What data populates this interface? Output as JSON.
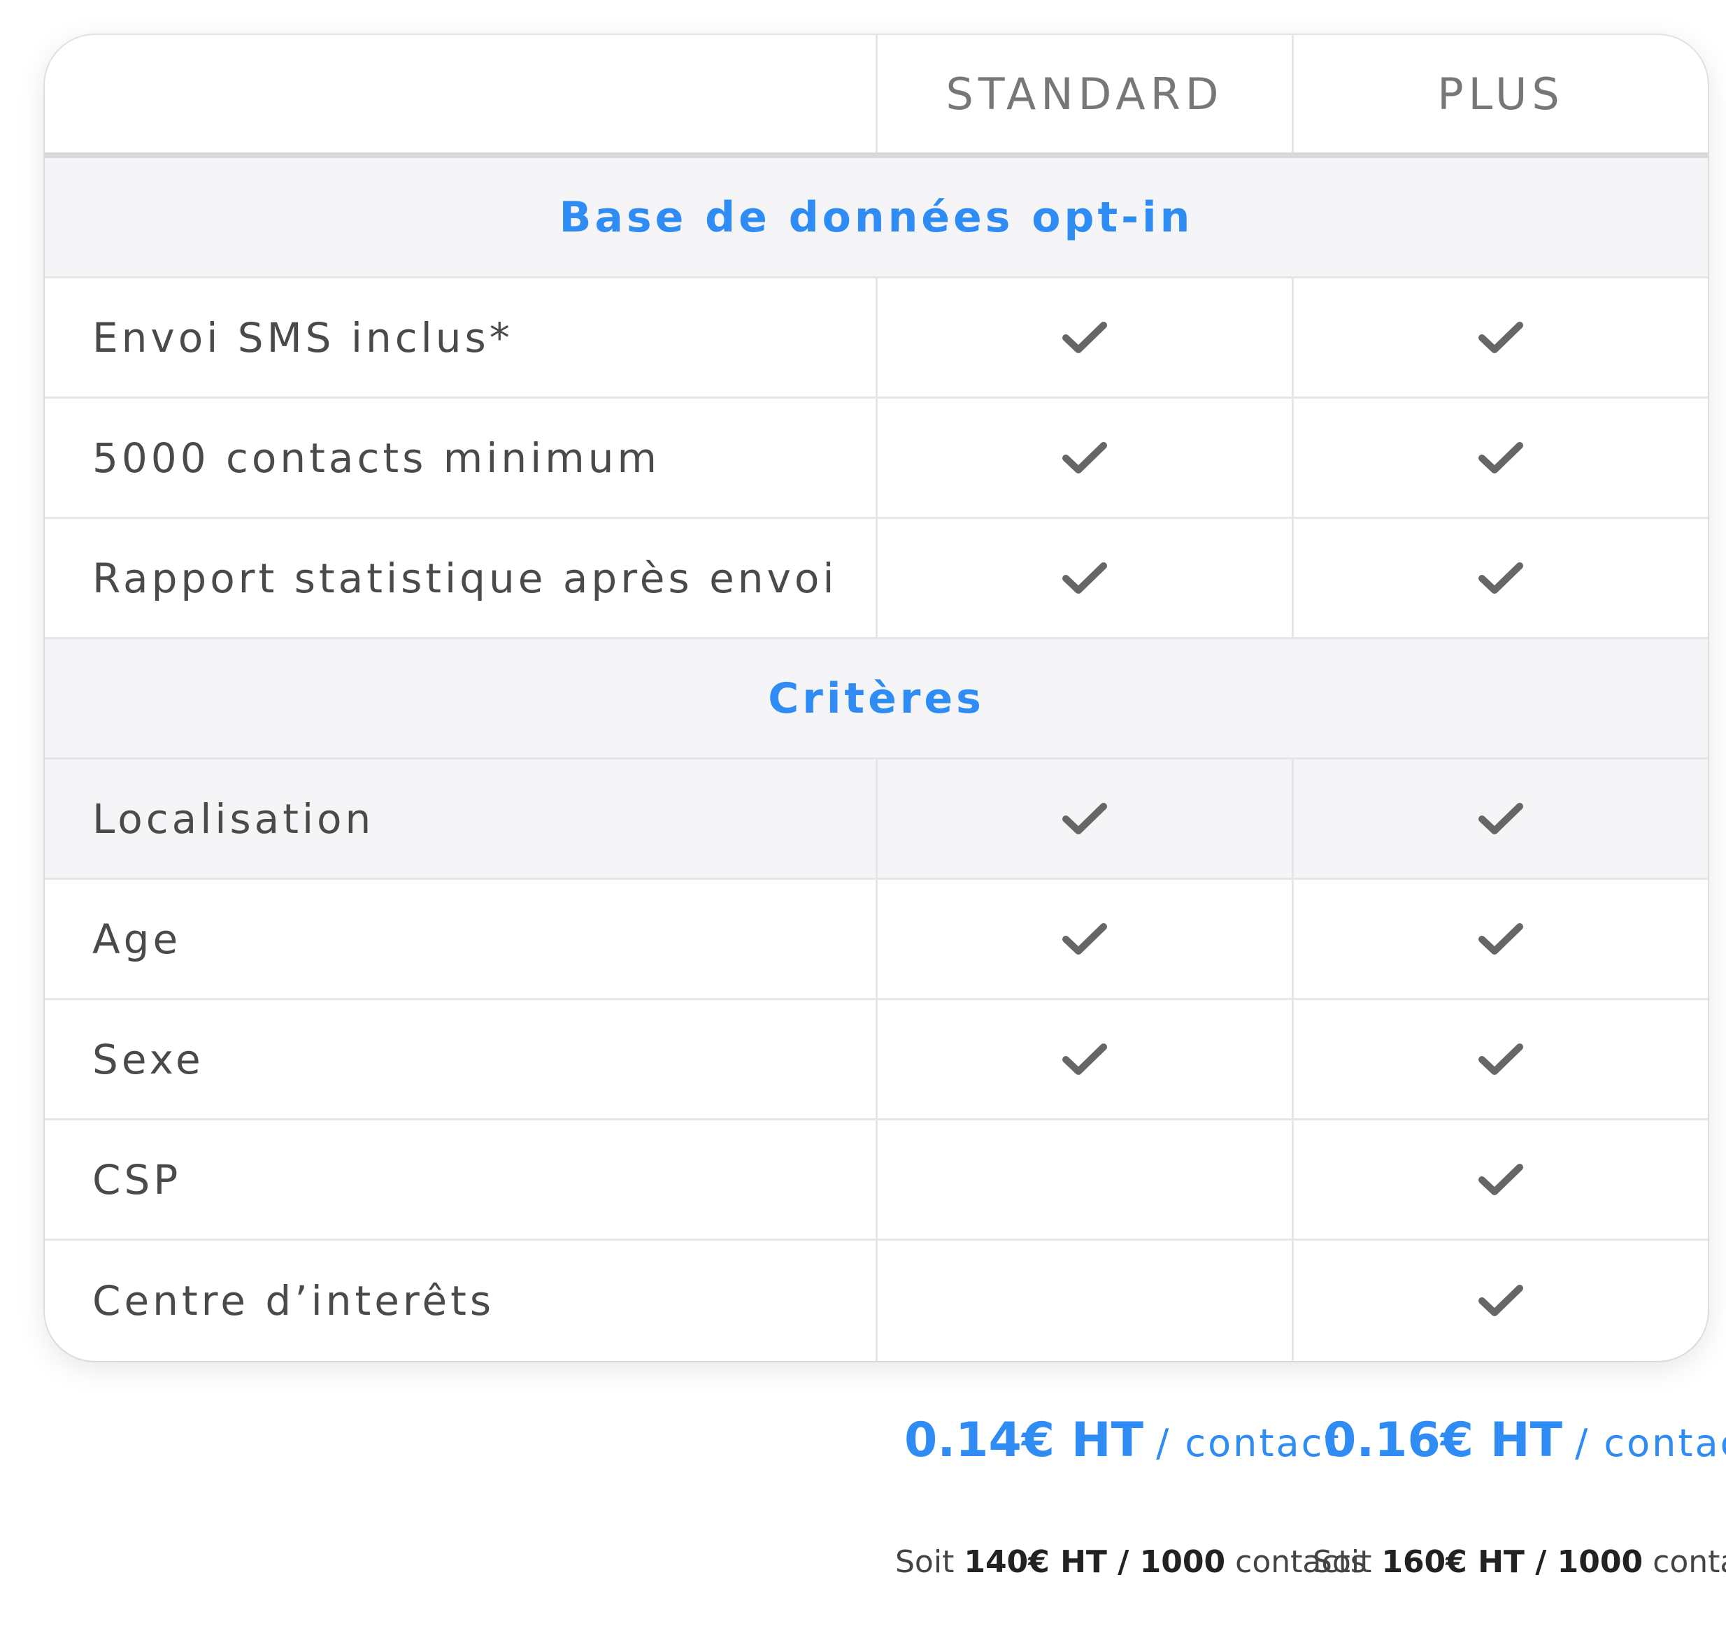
{
  "plans": [
    {
      "name": "STANDARD",
      "price": "0.14€ HT",
      "price_unit": "/ contact",
      "soit_prefix": "Soit",
      "soit_value": "140€ HT / 1000",
      "soit_suffix": "contacts"
    },
    {
      "name": "PLUS",
      "price": "0.16€ HT",
      "price_unit": "/ contact",
      "soit_prefix": "Soit",
      "soit_value": "160€ HT / 1000",
      "soit_suffix": "contacts"
    }
  ],
  "sections": [
    {
      "title": "Base de données opt-in",
      "rows": [
        {
          "label": "Envoi SMS inclus*",
          "standard": true,
          "plus": true
        },
        {
          "label": "5000 contacts minimum",
          "standard": true,
          "plus": true
        },
        {
          "label": "Rapport statistique après envoi",
          "standard": true,
          "plus": true
        }
      ]
    },
    {
      "title": "Critères",
      "rows": [
        {
          "label": "Localisation",
          "standard": true,
          "plus": true
        },
        {
          "label": "Age",
          "standard": true,
          "plus": true
        },
        {
          "label": "Sexe",
          "standard": true,
          "plus": true
        },
        {
          "label": "CSP",
          "standard": false,
          "plus": true
        },
        {
          "label": "Centre d’interêts",
          "standard": false,
          "plus": true
        }
      ]
    }
  ],
  "colors": {
    "accent": "#2f8cf5",
    "check": "#666666",
    "section_bg": "#f5f5f7"
  },
  "icons": {
    "included": "check-icon"
  }
}
